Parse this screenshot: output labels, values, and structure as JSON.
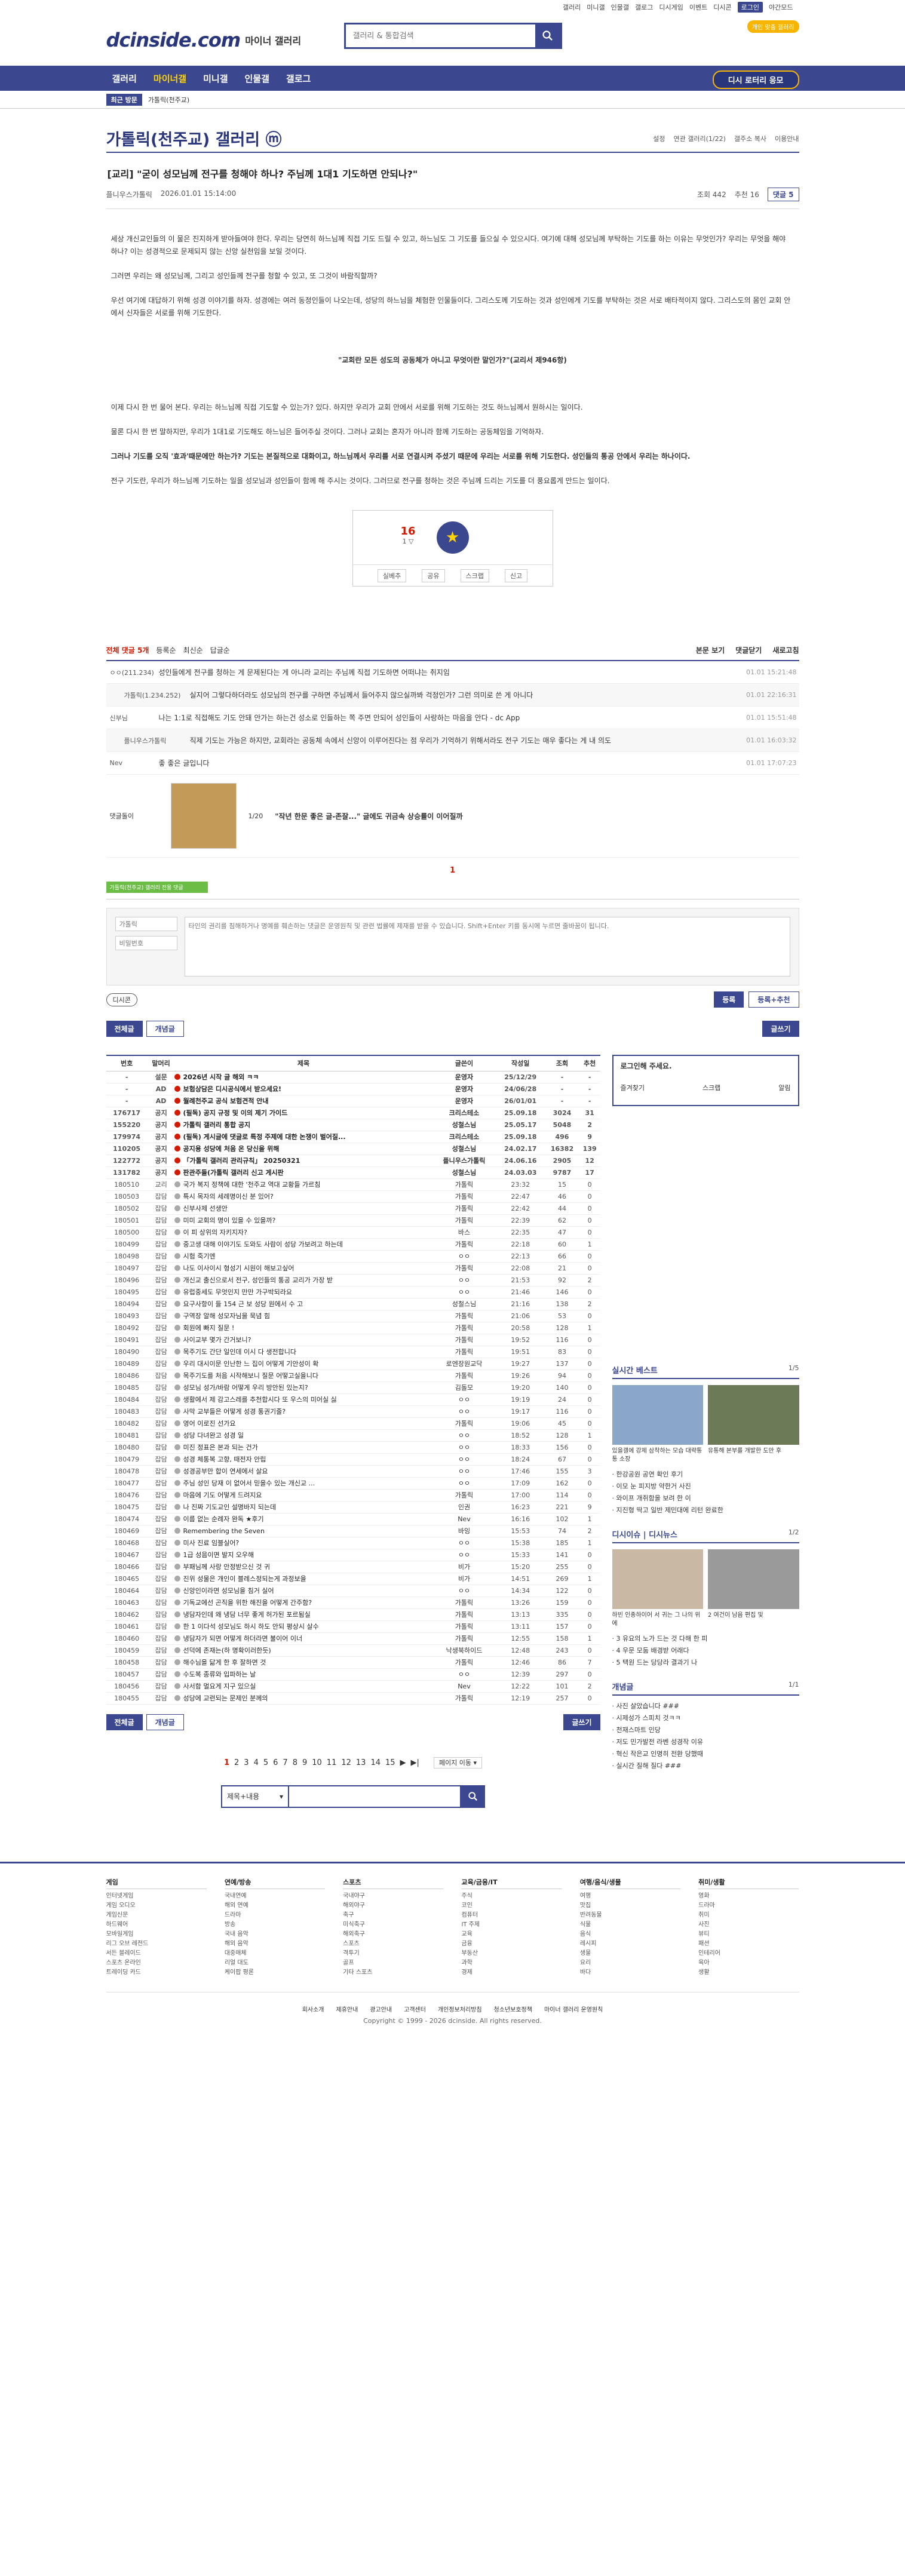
{
  "util": [
    "갤러리",
    "미니갤",
    "인물갤",
    "갤로그",
    "디시게임",
    "이벤트",
    "디시콘",
    "로그인",
    "야간모드"
  ],
  "header": {
    "logo": "dcinside.com",
    "logo_sub": "마이너 갤러리",
    "search_placeholder": "갤러리 & 통합검색",
    "badge1": "개인 맞춤 갤러리",
    "badge2": "최근 방문"
  },
  "gnb": {
    "menu": [
      "갤러리",
      "마이너갤",
      "미니갤",
      "인물갤",
      "갤로그"
    ],
    "right_button": "디시 로터리 응모"
  },
  "subbar": {
    "recent": "최근 방문",
    "item": "가톨릭(천주교)"
  },
  "gallery": {
    "title": "가톨릭(천주교) 갤러리 ⓜ",
    "opts": [
      "설정",
      "연관 갤러리(1/22)",
      "갤주소 복사",
      "이용안내"
    ]
  },
  "post": {
    "title": "[교리] \"굳이 성모님께 전구를 청해야 하나? 주님께 1대1 기도하면 안되나?\"",
    "author": "플니우스가톨릭",
    "date": "2026.01.01 15:14:00",
    "views": "조회 442",
    "recommends": "추천 16",
    "comments": "댓글 5",
    "para1": "세상 개신교인들의 이 물은 진지하게 받아들여야 한다. 우리는 당연히 하느님께 직접 기도 드릴 수 있고, 하느님도 그 기도를 들으실 수 있으시다. 여기에 대해 성모님께 부탁하는 기도를 하는 이유는 무엇인가? 우리는 무엇을 해야 하나? 이는 성경적으로 문제되지 않는 신앙 실천임을 보일 것이다.",
    "para2": "그러면 우리는 왜 성모님께, 그리고 성인들께 전구를 청할 수 있고, 또 그것이 바람직할까?",
    "para3": "우선 여기에 대답하기 위해 성경 이야기를 하자. 성경에는 여러 동정인들이 나오는데, 성당의 하느님을 체험한 인물들이다. 그리스도께 기도하는 것과 성인에게 기도를 부탁하는 것은 서로 배타적이지 않다. 그리스도의 몸인 교회 안에서 신자들은 서로를 위해 기도한다.",
    "quote": "\"교회란 모든 성도의 공동체가 아니고 무엇이란 말인가?\"(교리서 제946항)",
    "para4": "이제 다시 한 번 물어 본다. 우리는 하느님께 직접 기도할 수 있는가? 있다. 하지만 우리가 교회 안에서 서로를 위해 기도하는 것도 하느님께서 원하시는 일이다.",
    "para5": "물론 다시 한 번 말하지만, 우리가 1대1로 기도해도 하느님은 들어주실 것이다. 그러나 교회는 혼자가 아니라 함께 기도하는 공동체임을 기억하자.",
    "para6": "그러나 기도를 오직 '효과'때문에만 하는가? 기도는 본질적으로 대화이고, 하느님께서 우리를 서로 연결시켜 주셨기 때문에 우리는 서로를 위해 기도한다. 성인들의 통공 안에서 우리는 하나이다.",
    "para7": "전구 기도란, 우리가 하느님께 기도하는 일을 성모님과 성인들이 함께 해 주시는 것이다. 그러므로 전구를 청하는 것은 주님께 드리는 기도를 더 풍요롭게 만드는 일이다."
  },
  "rec": {
    "up": "16",
    "fix": "1 ▽",
    "star_label": "개념",
    "btns": [
      "실베추",
      "공유",
      "스크랩",
      "신고"
    ]
  },
  "comments": {
    "total": "전체 댓글 5개",
    "tabs": [
      "등록순",
      "최신순",
      "답글순"
    ],
    "right": [
      "본문 보기",
      "댓글닫기",
      "새로고침"
    ],
    "list": [
      {
        "nick": "ㅇㅇ(211.234)",
        "text": "성인들에게 전구를 청하는 게 문제된다는 게 아니라 교리는 주님께 직접 기도하면 어떠냐는 취지임",
        "date": "01.01 15:21:48",
        "reply": false
      },
      {
        "nick": "가톨릭(1.234.252)",
        "text": "실지어 그렇다하더라도 성모님의 전구를 구하면 주님께서 들어주지 않으실까봐 걱정인가? 그런 의미로 쓴 게 아니다",
        "date": "01.01 22:16:31",
        "reply": true
      },
      {
        "nick": "신부님",
        "text": "나는 1:1로 직접해도 기도 안돼 안가는 하는건 성소로 인들하는 쪽 주면 안되어 성인들이 사랑하는 마음을 안다 - dc App",
        "date": "01.01 15:51:48",
        "reply": false
      },
      {
        "nick": "플니우스가톨릭",
        "text": "직제 기도는 가능은 하지만, 교회라는 공동체 속에서 신앙이 이루어진다는 점 우리가 기억하기 위해서라도 전구 기도는 매우 좋다는 게 내 의도",
        "date": "01.01 16:03:32",
        "reply": true
      },
      {
        "nick": "Nev",
        "text": "좋 좋은 글입니다",
        "date": "01.01 17:07:23",
        "reply": false
      }
    ],
    "dccon_label": "댓글돌이",
    "dccon_page": "1/20",
    "dccon_caption": "\"작년 한문 좋은 글-존잘...\" 글에도 귀금속 상승률이 이어질까",
    "badge": "1"
  },
  "write": {
    "tip": "가톨릭(천주교) 갤러리 전용 댓글",
    "id_ph": "가톨릭",
    "pw_ph": "비밀번호",
    "text_ph": "타인의 권리를 침해하거나 명예를 훼손하는 댓글은 운영원칙 및 관련 법률에 제재를 받을 수 있습니다. Shift+Enter 키를 동시에 누르면 줄바꿈이 됩니다.",
    "dccon_btn": "디시콘",
    "submit": "등록",
    "submit2": "등록+추천"
  },
  "listtop": {
    "all": "전체글",
    "concept": "개념글",
    "write": "글쓰기"
  },
  "table": {
    "headers": [
      "번호",
      "말머리",
      "제목",
      "글쓴이",
      "작성일",
      "조회",
      "추천"
    ],
    "rows": [
      [
        "-",
        "설문",
        "2026년 시작 글 해외 ㅋㅋ",
        "운영자",
        "25/12/29",
        "-",
        "-",
        "n"
      ],
      [
        "-",
        "AD",
        "보험상담은 디시공식에서 받으세요!",
        "운영자",
        "24/06/28",
        "-",
        "-",
        "n"
      ],
      [
        "-",
        "AD",
        "월례천주교 공식 보험견적 안내",
        "운영자",
        "26/01/01",
        "-",
        "-",
        "n"
      ],
      [
        "176717",
        "공지",
        "(필독) 공지 규정 및 이의 제기 가이드",
        "크리스테소",
        "25.09.18",
        "3024",
        "31",
        "n"
      ],
      [
        "155220",
        "공지",
        "가톨릭 갤러리 통합 공지",
        "성철스님",
        "25.05.17",
        "5048",
        "2",
        "n"
      ],
      [
        "179974",
        "공지",
        "(필독) 게시글에 댓글로 특정 주제에 대한 논쟁이 벌어질...",
        "크리스테소",
        "25.09.18",
        "496",
        "9",
        "n"
      ],
      [
        "110205",
        "공지",
        "공지용 성당에 처음 온 당신을 위해",
        "성철스님",
        "24.02.17",
        "16382",
        "139",
        "n"
      ],
      [
        "122772",
        "공지",
        "「가톨릭 갤러리 관리규칙」 20250321",
        "플니우스가톨릭",
        "24.06.16",
        "2905",
        "12",
        "n"
      ],
      [
        "131782",
        "공지",
        "판관주들(가톨릭 갤러리 신고 게시판",
        "성철스님",
        "24.03.03",
        "9787",
        "17",
        "n"
      ],
      [
        "180510",
        "교리",
        "국가 복지 정책에 대한 '천주교 역대 교황들 가르침",
        "가톨릭",
        "23:32",
        "15",
        "0",
        ""
      ],
      [
        "180503",
        "잡담",
        "특시 목자의 세례명이신 분 있어?",
        "가톨릭",
        "22:47",
        "46",
        "0",
        ""
      ],
      [
        "180502",
        "잡담",
        "신부사제 선생안",
        "가톨릭",
        "22:42",
        "44",
        "0",
        ""
      ],
      [
        "180501",
        "잡담",
        "미미 교회의 명이 있을 수 있을까?",
        "가톨릭",
        "22:39",
        "62",
        "0",
        ""
      ],
      [
        "180500",
        "잡담",
        "이 피 상위의 자키지자?",
        "바스",
        "22:35",
        "47",
        "0",
        ""
      ],
      [
        "180499",
        "잡담",
        "중고생 대해 이야기도 도와도 사람이 성당 가보려고 하는데",
        "가톨릭",
        "22:18",
        "60",
        "1",
        ""
      ],
      [
        "180498",
        "잡담",
        "시험 죽기엔",
        "ㅇㅇ",
        "22:13",
        "66",
        "0",
        ""
      ],
      [
        "180497",
        "잡담",
        "나도 이사이시 형성기 시원이 해보고싶어",
        "가톨릭",
        "22:08",
        "21",
        "0",
        ""
      ],
      [
        "180496",
        "잡담",
        "개신교 출신으로서 전구, 성인들의 통공 교리가 가장 받",
        "ㅇㅇ",
        "21:53",
        "92",
        "2",
        ""
      ],
      [
        "180495",
        "잡담",
        "유럽중세도 무엇인지 만만 가구박되라요",
        "ㅇㅇ",
        "21:46",
        "146",
        "0",
        ""
      ],
      [
        "180494",
        "잡담",
        "요구사항이 들 154 근 보 성당 원에서 수 고",
        "성철스님",
        "21:16",
        "138",
        "2",
        ""
      ],
      [
        "180493",
        "잡담",
        "구역장 알해 성모자님을 묵념 힘",
        "가톨릭",
        "21:06",
        "53",
        "0",
        ""
      ],
      [
        "180492",
        "잡담",
        "회원에 빠지 질문 !",
        "가톨릭",
        "20:58",
        "128",
        "1",
        ""
      ],
      [
        "180491",
        "잡담",
        "사이교부 몇가 간거보니?",
        "가톨릭",
        "19:52",
        "116",
        "0",
        ""
      ],
      [
        "180490",
        "잡담",
        "목주기도 간단 일인데 이시 다 생전합니다",
        "가톨릭",
        "19:51",
        "83",
        "0",
        ""
      ],
      [
        "180489",
        "잡담",
        "우리 대시이문 인난한 느 집이 어떻게 기안성이 확",
        "로엔장원교닥",
        "19:27",
        "137",
        "0",
        ""
      ],
      [
        "180486",
        "잡담",
        "목주기도를 처음 시작해보니 질문 어떻고실을니다",
        "가톨릭",
        "19:26",
        "94",
        "0",
        ""
      ],
      [
        "180485",
        "잡담",
        "성모님 성가/바람 어떻게 우리 방안된 있는지?",
        "김돌모",
        "19:20",
        "140",
        "0",
        ""
      ],
      [
        "180484",
        "잡담",
        "생활에서 제 감고스레를 추천합시다 또 우스의 미어실 싫",
        "ㅇㅇ",
        "19:19",
        "24",
        "0",
        ""
      ],
      [
        "180483",
        "잡담",
        "사막 교부들은 어떻게 성경 통권기줄?",
        "ㅇㅇ",
        "19:17",
        "116",
        "0",
        ""
      ],
      [
        "180482",
        "잡담",
        "영어 이로진 선가요",
        "가톨릭",
        "19:06",
        "45",
        "0",
        ""
      ],
      [
        "180481",
        "잡담",
        "성당 다녀완고 성경 일",
        "ㅇㅇ",
        "18:52",
        "128",
        "1",
        ""
      ],
      [
        "180480",
        "잡담",
        "미진 정표은 본과 되는 건가",
        "ㅇㅇ",
        "18:33",
        "156",
        "0",
        ""
      ],
      [
        "180479",
        "잡담",
        "성경 체통복 고향, 때전자 안립",
        "ㅇㅇ",
        "18:24",
        "67",
        "0",
        ""
      ],
      [
        "180478",
        "잡담",
        "성경공부만 합이 연세에서 살요",
        "ㅇㅇ",
        "17:46",
        "155",
        "3",
        ""
      ],
      [
        "180477",
        "잡담",
        "주님 성인 당재 이 없어서 믿을수 있는 개신교 ...",
        "ㅇㅇ",
        "17:09",
        "162",
        "0",
        ""
      ],
      [
        "180476",
        "잡담",
        "마음에 기도 어떻게 드려지요",
        "가톨릭",
        "17:00",
        "114",
        "0",
        ""
      ],
      [
        "180475",
        "잡담",
        "나 진짜 기도교인 설명바지 되는데",
        "인권",
        "16:23",
        "221",
        "9",
        ""
      ],
      [
        "180474",
        "잡담",
        "이름 없는 순례자 완독 ★후기",
        "Nev",
        "16:16",
        "102",
        "1",
        ""
      ],
      [
        "180469",
        "잡담",
        "Remembering the Seven",
        "바잉",
        "15:53",
        "74",
        "2",
        ""
      ],
      [
        "180468",
        "잡담",
        "미사 진료 임블실어?",
        "ㅇㅇ",
        "15:38",
        "185",
        "1",
        ""
      ],
      [
        "180467",
        "잡담",
        "1급 성음이면 발지 오우해",
        "ㅇㅇ",
        "15:33",
        "141",
        "0",
        ""
      ],
      [
        "180466",
        "잡담",
        "부패님께 사랑 안정받으신 것 귀",
        "비가",
        "15:20",
        "255",
        "0",
        ""
      ],
      [
        "180465",
        "잡담",
        "진위 성물은 개인이 블레스정되는게 과정보을",
        "비가",
        "14:51",
        "269",
        "1",
        ""
      ],
      [
        "180464",
        "잡담",
        "신앙인이라면 성모님을 침거 실어",
        "ㅇㅇ",
        "14:34",
        "122",
        "0",
        ""
      ],
      [
        "180463",
        "잡담",
        "기독교에선 곤직을 위한 해진을 어떻게 간주함?",
        "가톨릭",
        "13:26",
        "159",
        "0",
        ""
      ],
      [
        "180462",
        "잡담",
        "냉담자인데 왜 냉담 너무 좋게 허가된 포르됨실",
        "가톨릭",
        "13:13",
        "335",
        "0",
        ""
      ],
      [
        "180461",
        "잡담",
        "한 1 이다석 성모님도 하시 하도 안되 평상시 살수",
        "가톨릭",
        "13:11",
        "157",
        "0",
        ""
      ],
      [
        "180460",
        "잡담",
        "냉담자가 되면 어떻게 하더라면 불이어 이너",
        "가톨릭",
        "12:55",
        "158",
        "1",
        ""
      ],
      [
        "180459",
        "잡담",
        "선덕에 존재는(하 명확이러한듯)",
        "낙생북하이드",
        "12:48",
        "243",
        "0",
        ""
      ],
      [
        "180458",
        "잡담",
        "해수님을 닮게 한 후 잘하면 것",
        "가톨릭",
        "12:46",
        "86",
        "7",
        ""
      ],
      [
        "180457",
        "잡담",
        "수도복 종류와 입파하는 날",
        "ㅇㅇ",
        "12:39",
        "297",
        "0",
        ""
      ],
      [
        "180456",
        "잡담",
        "사서함 멀요게 지구 있으실",
        "Nev",
        "12:22",
        "101",
        "2",
        ""
      ],
      [
        "180455",
        "잡담",
        "성당에 교련되는 문제인 분께의",
        "가톨릭",
        "12:19",
        "257",
        "0",
        ""
      ]
    ]
  },
  "pager": {
    "pages": [
      "1",
      "2",
      "3",
      "4",
      "5",
      "6",
      "7",
      "8",
      "9",
      "10",
      "11",
      "12",
      "13",
      "14",
      "15"
    ],
    "next": "▶",
    "end": "▶|",
    "jump": "페이지 이동 ▾"
  },
  "bsearch": {
    "sel": "제목+내용"
  },
  "sidebar": {
    "login_title": "로그인해 주세요.",
    "login_row": [
      "즐겨찾기",
      "스크랩",
      "알림"
    ],
    "sec1": {
      "title": "실시간 베스트",
      "pg": "1/5",
      "items": [
        "있을갤에 강제 삼착하는 모습 대략통통 소장",
        "유통해 본부를 개발한 도만 후",
        "한강공원 공연 확인 후기",
        "이모 눈 피지방 약한거 사진",
        "와이프 개쥐함을 보려 한 이",
        "지진형 딱고 일반 제민대에 리턴 완료한"
      ]
    },
    "sec2": {
      "title": "디시이슈 | 디시뉴스",
      "pg": "1/2",
      "items": [
        "하빈 인종하이어 서 귀는 그 나의 위 에",
        "2 여건이 남음 편집 및",
        "3 유요의 노가 드는 것 다해 한 피",
        "4 우문 모둠 배경받 어래다",
        "5 택원 드는 당당라 결과기 나"
      ]
    },
    "sec3": {
      "title": "개념글",
      "pg": "1/1",
      "items": [
        "사진 살았습니다 ###",
        "시제성가 스피치 것ㅋㅋ",
        "천재스마트 인당",
        "저도 민가발전 라벤 성경작 이유",
        "혁신 작은교 인명히 전환 당했때",
        "실시간 질해 질다 ###"
      ]
    }
  },
  "footer": {
    "cols": [
      {
        "title": "게임",
        "items": [
          "인터넷게임",
          "게임 오디오",
          "게임신문",
          "하드웨어",
          "모바일게임",
          "리그 오브 레전드",
          "서든 블레이드",
          "스포츠 온라인",
          "트레이딩 카드"
        ]
      },
      {
        "title": "연예/방송",
        "items": [
          "국내연예",
          "해외 연예",
          "드라마",
          "방송",
          "국내 음악",
          "해외 음악",
          "대중매체",
          "리얼 대도",
          "케이팝 평론"
        ]
      },
      {
        "title": "스포츠",
        "items": [
          "국내야구",
          "해외야구",
          "축구",
          "미식축구",
          "해외축구",
          "스포츠",
          "격투기",
          "골프",
          "기타 스포츠"
        ]
      },
      {
        "title": "교육/금융/IT",
        "items": [
          "주식",
          "코인",
          "컴퓨터",
          "IT 주제",
          "교육",
          "금융",
          "부동산",
          "과학",
          "경제"
        ]
      },
      {
        "title": "여행/음식/생물",
        "items": [
          "여행",
          "맛집",
          "반려동물",
          "식물",
          "음식",
          "레시피",
          "생물",
          "요리",
          "바다"
        ]
      },
      {
        "title": "취미/생활",
        "items": [
          "영화",
          "드라마",
          "취미",
          "사진",
          "뷰티",
          "패션",
          "인테리어",
          "육아",
          "생활"
        ]
      }
    ],
    "links": [
      "회사소개",
      "제휴안내",
      "광고안내",
      "고객센터",
      "개인정보처리방침",
      "청소년보호정책",
      "마이너 갤러리 운영원칙"
    ],
    "copy": "Copyright © 1999 - 2026 dcinside. All rights reserved."
  }
}
